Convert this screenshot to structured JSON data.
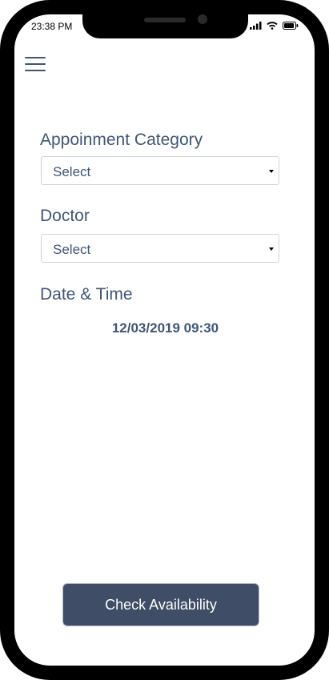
{
  "status_bar": {
    "time": "23:38 PM"
  },
  "icons": {
    "menu": "hamburger-menu-icon",
    "signal": "cellular-signal-icon",
    "wifi": "wifi-icon",
    "battery": "battery-icon"
  },
  "form": {
    "category_label": "Appoinment Category",
    "category_value": "Select",
    "doctor_label": "Doctor",
    "doctor_value": "Select",
    "datetime_label": "Date & Time",
    "datetime_value": "12/03/2019 09:30"
  },
  "actions": {
    "check_label": "Check Availability"
  },
  "colors": {
    "text_primary": "#3f5677",
    "button_bg": "#3f4d66",
    "frame": "#000000"
  }
}
